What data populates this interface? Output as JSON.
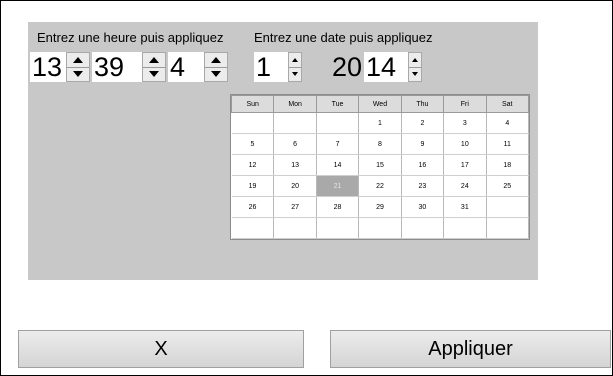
{
  "time": {
    "label": "Entrez une heure puis appliquez",
    "hour": "13",
    "minute": "39",
    "second": "4"
  },
  "date": {
    "label": "Entrez une date puis appliquez",
    "day": "1",
    "century": "20",
    "year": "14"
  },
  "calendar": {
    "headers": [
      "Sun",
      "Mon",
      "Tue",
      "Wed",
      "Thu",
      "Fri",
      "Sat"
    ],
    "weeks": [
      [
        "",
        "",
        "",
        "1",
        "2",
        "3",
        "4"
      ],
      [
        "5",
        "6",
        "7",
        "8",
        "9",
        "10",
        "11"
      ],
      [
        "12",
        "13",
        "14",
        "15",
        "16",
        "17",
        "18"
      ],
      [
        "19",
        "20",
        "21",
        "22",
        "23",
        "24",
        "25"
      ],
      [
        "26",
        "27",
        "28",
        "29",
        "30",
        "31",
        ""
      ],
      [
        "",
        "",
        "",
        "",
        "",
        "",
        ""
      ]
    ],
    "selected": "21"
  },
  "buttons": {
    "cancel": "X",
    "apply": "Appliquer"
  }
}
